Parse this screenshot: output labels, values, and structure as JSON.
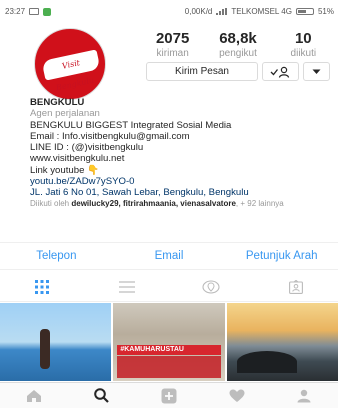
{
  "status_bar": {
    "time": "23:27",
    "network_speed": "0,00K/d",
    "carrier": "TELKOMSEL 4G",
    "battery": "51%"
  },
  "profile": {
    "avatar_text": "Visit Bengkulu",
    "stats": [
      {
        "value": "2075",
        "label": "kiriman"
      },
      {
        "value": "68,8k",
        "label": "pengikut"
      },
      {
        "value": "10",
        "label": "diikuti"
      }
    ],
    "message_button": "Kirim Pesan"
  },
  "bio": {
    "name": "BENGKULU",
    "category": "Agen perjalanan",
    "lines": [
      "BENGKULU BIGGEST Integrated Sosial Media",
      "Email : Info.visitbengkulu@gmail.com",
      "LINE ID : (@)visitbengkulu",
      "www.visitbengkulu.net",
      "Link youtube 👇"
    ],
    "link": "youtu.be/ZADw7ySYO-0",
    "address": "JL. Jati 6 No 01, Sawah Lebar, Bengkulu, Bengkulu",
    "followed_prefix": "Diikuti oleh",
    "followed_names": "dewilucky29, fitrirahmaania, vienasalvatore",
    "followed_suffix": ", + 92 lainnya"
  },
  "contact": {
    "call": "Telepon",
    "email": "Email",
    "directions": "Petunjuk Arah"
  },
  "tabs": [
    "grid-icon",
    "list-icon",
    "location-icon",
    "tagged-icon"
  ],
  "grid": {
    "post2_banner": "#KAMUHARUSTAU"
  },
  "bottom_nav": [
    "home-icon",
    "search-icon",
    "add-icon",
    "heart-icon",
    "profile-icon"
  ],
  "colors": {
    "accent_blue": "#3897f0",
    "brand_red": "#d0101a",
    "muted_gray": "#999999"
  }
}
